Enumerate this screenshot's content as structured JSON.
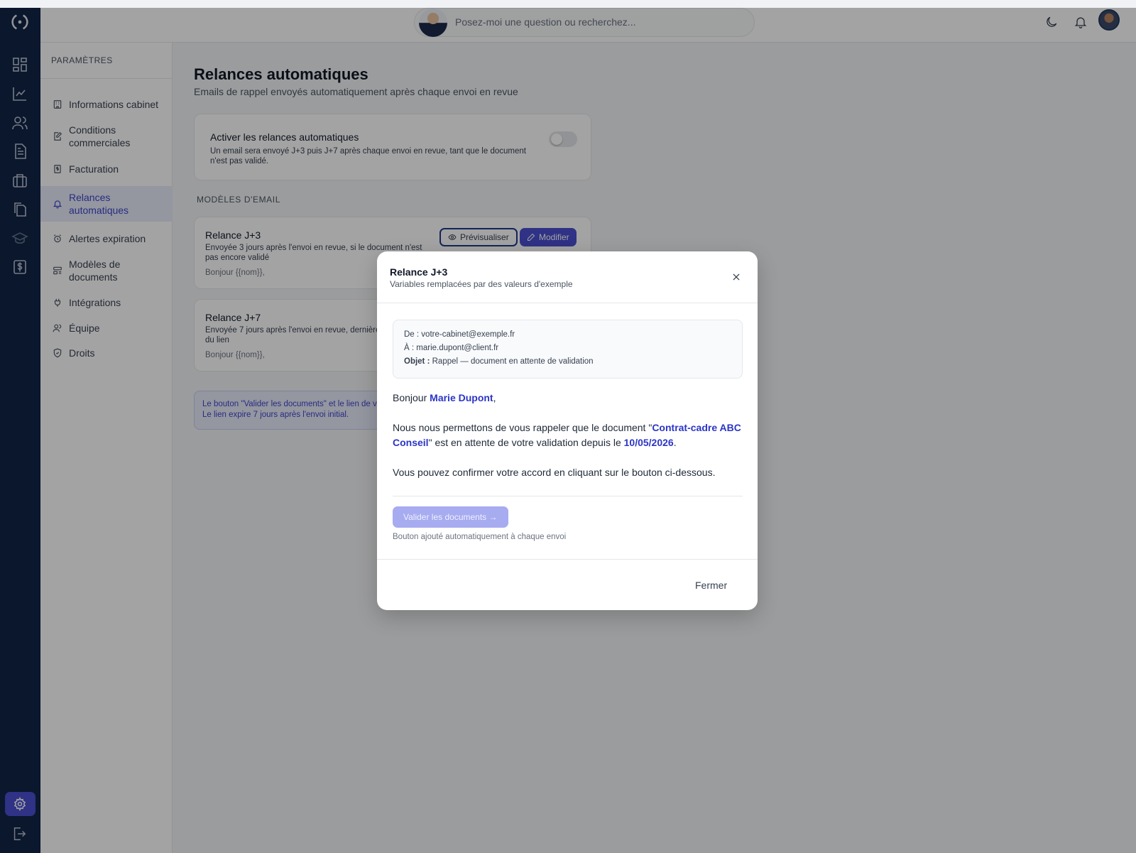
{
  "header": {
    "search_placeholder": "Posez-moi une question ou recherchez..."
  },
  "sidenav": {
    "section": "PARAMÈTRES",
    "items": [
      {
        "label": "Informations cabinet",
        "icon": "building-icon"
      },
      {
        "label": "Conditions commerciales",
        "icon": "document-edit-icon"
      },
      {
        "label": "Facturation",
        "icon": "invoice-icon"
      },
      {
        "label": "Relances automatiques",
        "icon": "bell-icon",
        "active": true
      },
      {
        "label": "Alertes expiration",
        "icon": "alarm-icon"
      },
      {
        "label": "Modèles de documents",
        "icon": "template-icon"
      },
      {
        "label": "Intégrations",
        "icon": "plug-icon"
      },
      {
        "label": "Équipe",
        "icon": "users-icon"
      },
      {
        "label": "Droits",
        "icon": "shield-icon"
      }
    ]
  },
  "page": {
    "title": "Relances automatiques",
    "subtitle": "Emails de rappel envoyés automatiquement après chaque envoi en revue",
    "toggle_card": {
      "title": "Activer les relances automatiques",
      "description": "Un email sera envoyé J+3 puis J+7 après chaque envoi en revue, tant que le document n'est pas validé.",
      "enabled": false
    },
    "templates_header": "MODÈLES D'EMAIL",
    "templates": [
      {
        "title": "Relance J+3",
        "description": "Envoyée 3 jours après l'envoi en revue, si le document n'est pas encore validé",
        "snippet": "Bonjour {{nom}},"
      },
      {
        "title": "Relance J+7",
        "description": "Envoyée 7 jours après l'envoi en revue, dernière expiration du lien",
        "snippet": "Bonjour {{nom}},"
      }
    ],
    "preview_label": "Prévisualiser",
    "edit_label": "Modifier",
    "info_line1": "Le bouton \"Valider les documents\" et le lien de v",
    "info_line2": "Le lien expire 7 jours après l'envoi initial."
  },
  "modal": {
    "title": "Relance J+3",
    "subtitle": "Variables remplacées par des valeurs d'exemple",
    "from_label": "De :",
    "from_value": "votre-cabinet@exemple.fr",
    "to_label": "À :",
    "to_value": "marie.dupont@client.fr",
    "subject_label": "Objet :",
    "subject_value": "Rappel — document en attente de validation",
    "greeting": "Bonjour",
    "recipient_name": "Marie Dupont",
    "p1_before": "Nous nous permettons de vous rappeler que le document \"",
    "document_name": "Contrat-cadre ABC Conseil",
    "p1_middle": "\" est en attente de votre validation depuis le",
    "date": "10/05/2026",
    "p2": "Vous pouvez confirmer votre accord en cliquant sur le bouton ci-dessous.",
    "validate_button": "Valider les documents →",
    "validate_note": "Bouton ajouté automatiquement à chaque envoi",
    "close_label": "Fermer"
  },
  "colors": {
    "rail": "#102447",
    "accent": "#4a4fd1",
    "highlight": "#2b35c5",
    "active_bg": "#e8ebfb"
  }
}
